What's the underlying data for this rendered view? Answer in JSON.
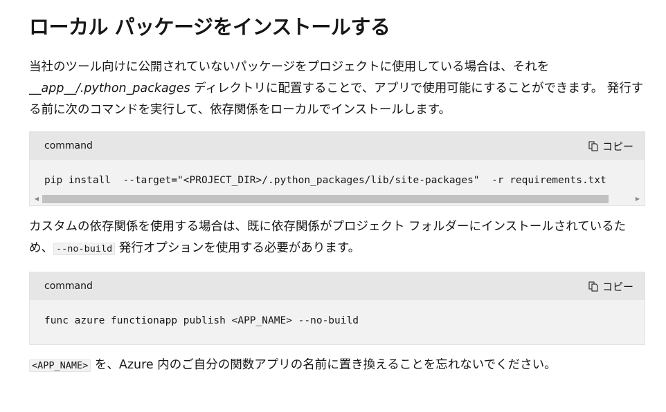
{
  "heading": "ローカル パッケージをインストールする",
  "intro": {
    "part1": "当社のツール向けに公開されていないパッケージをプロジェクトに使用している場合は、それを",
    "path": "__app__/.python_packages",
    "part2": " ディレクトリに配置することで、アプリで使用可能にすることができます。 発行する前に次のコマンドを実行して、依存関係をローカルでインストールします。"
  },
  "code_blocks": [
    {
      "language_label": "command",
      "copy_label": "コピー",
      "code": "pip install  --target=\"<PROJECT_DIR>/.python_packages/lib/site-packages\"  -r requirements.txt"
    },
    {
      "language_label": "command",
      "copy_label": "コピー",
      "code": "func azure functionapp publish <APP_NAME> --no-build"
    }
  ],
  "para2": {
    "part1": "カスタムの依存関係を使用する場合は、既に依存関係がプロジェクト フォルダーにインストールされているため、",
    "inline_code": "--no-build",
    "part2": " 発行オプションを使用する必要があります。"
  },
  "para3": {
    "inline_code": "<APP_NAME>",
    "part1": " を、Azure 内のご自分の関数アプリの名前に置き換えることを忘れないでください。"
  },
  "icons": {
    "copy": "copy-icon",
    "scroll_left": "scroll-left-arrow-icon",
    "scroll_right": "scroll-right-arrow-icon"
  },
  "scroll": {
    "thumb_fraction": 0.96
  }
}
